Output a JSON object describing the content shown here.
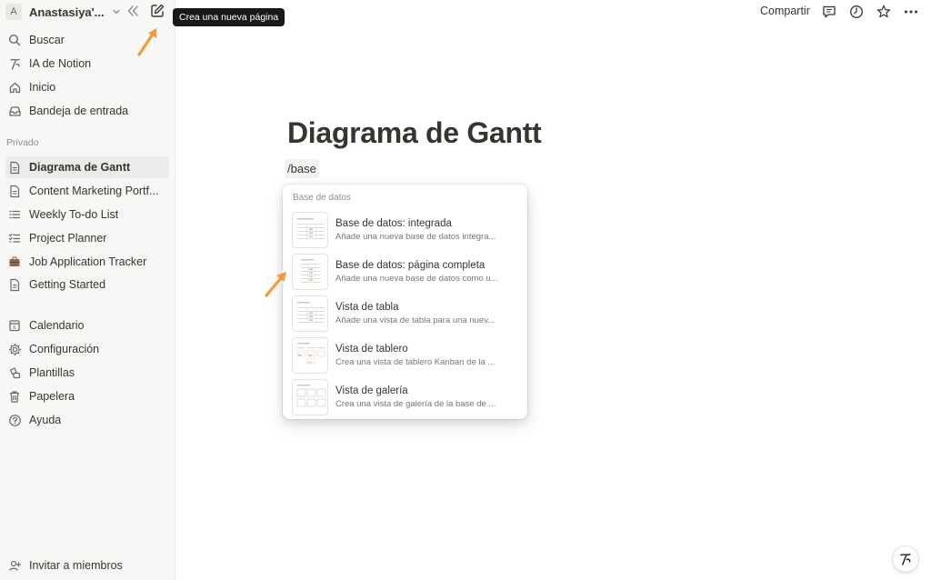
{
  "workspace": {
    "avatar_letter": "A",
    "name": "Anastasiya'..."
  },
  "tooltip": "Crea una nueva página",
  "nav": {
    "search": "Buscar",
    "ai": "IA de Notion",
    "home": "Inicio",
    "inbox": "Bandeja de entrada"
  },
  "private_label": "Privado",
  "pages": [
    {
      "label": "Diagrama de Gantt",
      "icon": "page-icon"
    },
    {
      "label": "Content Marketing Portf...",
      "icon": "page-icon"
    },
    {
      "label": "Weekly To-do List",
      "icon": "list-icon"
    },
    {
      "label": "Project Planner",
      "icon": "checklist-icon"
    },
    {
      "label": "Job Application Tracker",
      "icon": "briefcase-icon"
    },
    {
      "label": "Getting Started",
      "icon": "page-icon"
    }
  ],
  "bottom_nav": {
    "calendar": "Calendario",
    "settings": "Configuración",
    "templates": "Plantillas",
    "trash": "Papelera",
    "help": "Ayuda"
  },
  "invite": "Invitar a miembros",
  "topbar": {
    "share": "Compartir"
  },
  "page": {
    "title": "Diagrama de Gantt",
    "slash_command": "/base"
  },
  "menu": {
    "header": "Base de datos",
    "items": [
      {
        "title": "Base de datos: integrada",
        "desc": "Añade una nueva base de datos integra..."
      },
      {
        "title": "Base de datos: página completa",
        "desc": "Añade una nueva base de datos como u..."
      },
      {
        "title": "Vista de tabla",
        "desc": "Añade una vista de tabla para una nuev..."
      },
      {
        "title": "Vista de tablero",
        "desc": "Crea una vista de tablero Kanban de la ..."
      },
      {
        "title": "Vista de galería",
        "desc": "Crea una vista de galería de la base de ..."
      }
    ]
  },
  "colors": {
    "accent_arrow": "#f29a3a",
    "sidebar_bg": "#f7f7f5",
    "text": "#37352f"
  }
}
